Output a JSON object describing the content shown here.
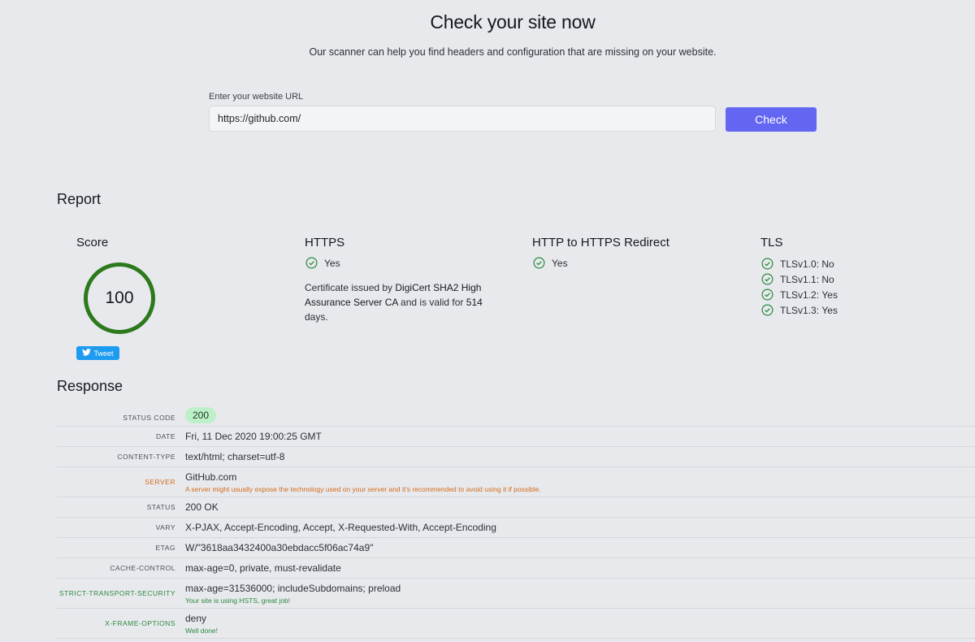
{
  "hero": {
    "title": "Check your site now",
    "subtitle": "Our scanner can help you find headers and configuration that are missing on your website."
  },
  "form": {
    "label": "Enter your website URL",
    "url_value": "https://github.com/",
    "button_label": "Check"
  },
  "report": {
    "title": "Report",
    "score": {
      "title": "Score",
      "value": "100",
      "tweet_label": "Tweet",
      "ring_color": "#2c7a1c"
    },
    "https": {
      "title": "HTTPS",
      "status": "Yes",
      "cert_prefix": "Certificate issued by ",
      "cert_issuer": "DigiCert SHA2 High Assurance Server CA",
      "cert_mid": " and is valid for ",
      "cert_days": "514",
      "cert_suffix": " days."
    },
    "redirect": {
      "title": "HTTP to HTTPS Redirect",
      "status": "Yes"
    },
    "tls": {
      "title": "TLS",
      "items": [
        {
          "label": "TLSv1.0:",
          "value": "No"
        },
        {
          "label": "TLSv1.1:",
          "value": "No"
        },
        {
          "label": "TLSv1.2:",
          "value": "Yes"
        },
        {
          "label": "TLSv1.3:",
          "value": "Yes"
        }
      ]
    }
  },
  "response": {
    "title": "Response",
    "rows": [
      {
        "key": "STATUS CODE",
        "value": "200",
        "badge": true
      },
      {
        "key": "DATE",
        "value": "Fri, 11 Dec 2020 19:00:25 GMT"
      },
      {
        "key": "CONTENT-TYPE",
        "value": "text/html; charset=utf-8"
      },
      {
        "key": "SERVER",
        "value": "GitHub.com",
        "note": "A server might usually expose the technology used on your server and it's recommended to avoid using it if possible.",
        "tone": "warn"
      },
      {
        "key": "STATUS",
        "value": "200 OK"
      },
      {
        "key": "VARY",
        "value": "X-PJAX, Accept-Encoding, Accept, X-Requested-With, Accept-Encoding"
      },
      {
        "key": "ETAG",
        "value": "W/\"3618aa3432400a30ebdacc5f06ac74a9\""
      },
      {
        "key": "CACHE-CONTROL",
        "value": "max-age=0, private, must-revalidate"
      },
      {
        "key": "STRICT-TRANSPORT-SECURITY",
        "value": "max-age=31536000; includeSubdomains; preload",
        "note": "Your site is using HSTS, great job!",
        "tone": "good"
      },
      {
        "key": "X-FRAME-OPTIONS",
        "value": "deny",
        "note": "Well done!",
        "tone": "good"
      }
    ]
  },
  "colors": {
    "accent": "#6366f1",
    "check_icon": "#2b8a3e",
    "warn": "#d16b1a",
    "good": "#2b8a3e"
  }
}
